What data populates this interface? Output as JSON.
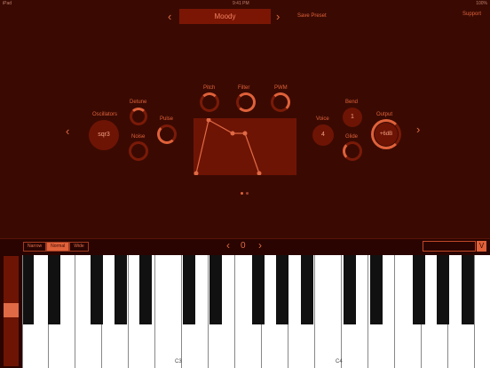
{
  "status": {
    "left": "iPad",
    "center": "9:41 PM",
    "right": "100%"
  },
  "preset": {
    "name": "Moody",
    "prev_icon": "chevron-left-icon",
    "next_icon": "chevron-right-icon",
    "save_label": "Save Preset",
    "support_label": "Support"
  },
  "labels": {
    "oscillators": "Oscillators",
    "detune": "Detune",
    "noise": "Noise",
    "pulse": "Pulse",
    "pitch": "Pitch",
    "filter": "Filter",
    "pwm": "PWM",
    "voice": "Voice",
    "bend": "Bend",
    "glide": "Glide",
    "output": "Output"
  },
  "values": {
    "oscillator": "sqr3",
    "voice": "4",
    "bend": "1",
    "output": "+6dB"
  },
  "keyboard": {
    "ranges": [
      "Narrow",
      "Normal",
      "Wide"
    ],
    "active_range": "Normal",
    "octave": "0",
    "v_button": "V",
    "labels": [
      "C3",
      "C4"
    ]
  },
  "colors": {
    "background": "#3a0a02",
    "accent": "#e0613a",
    "panel": "#6e1405"
  }
}
